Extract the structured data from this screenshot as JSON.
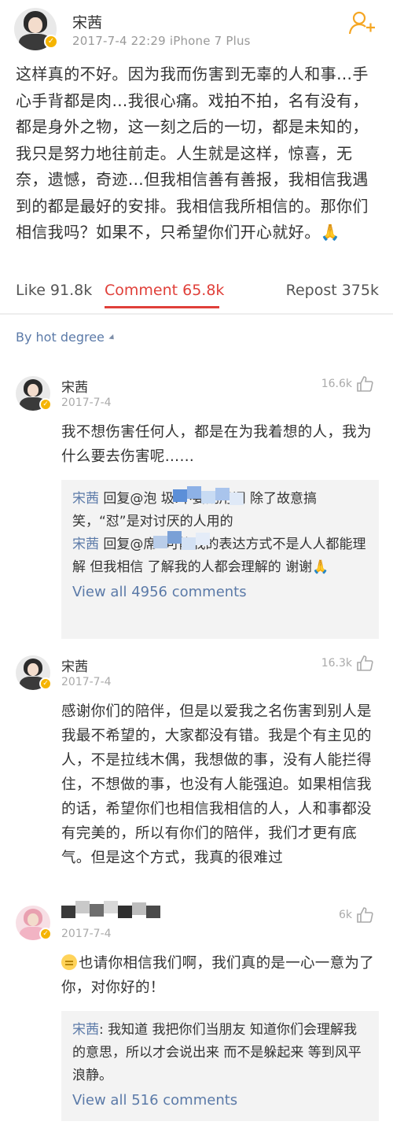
{
  "post": {
    "author": "宋茜",
    "meta": "2017-7-4 22:29   iPhone 7 Plus",
    "body": "这样真的不好。因为我而伤害到无辜的人和事…手心手背都是肉…我很心痛。戏拍不拍，名有没有，都是身外之物，这一刻之后的一切，都是未知的，我只是努力地往前走。人生就是这样，惊喜，无奈，遗憾，奇迹…但我相信善有善报，我相信我遇到的都是最好的安排。我相信我所相信的。那你们相信我吗？如果不，只希望你们开心就好。🙏"
  },
  "actions": {
    "like": "Like 91.8k",
    "comment": "Comment 65.8k",
    "repost": "Repost 375k"
  },
  "sort_label": "By hot degree",
  "comments": [
    {
      "name": "宋茜",
      "date": "2017-7-4",
      "likes": "16.6k",
      "text": "我不想伤害任何人，都是在为我着想的人，我为什么要去伤害呢……",
      "replies": [
        {
          "author": "宋茜",
          "text": " 回复@泡           圾:不要乱用词 除了故意搞笑，“怼”是对讨厌的人用的"
        },
        {
          "author": "宋茜",
          "text": " 回复@席     :可能我的表达方式不是人人都能理解 但我相信 了解我的人都会理解的 谢谢🙏"
        }
      ],
      "view_all": "View all 4956 comments"
    },
    {
      "name": "宋茜",
      "date": "2017-7-4",
      "likes": "16.3k",
      "text": "感谢你们的陪伴，但是以爱我之名伤害到别人是我最不希望的，大家都没有错。我是个有主见的人，不是拉线木偶，我想做的事，没有人能拦得住，不想做的事，也没有人能强迫。如果相信我的话，希望你们也相信我相信的人，人和事都没有完美的，所以有你们的陪伴，我们才更有底气。但是这个方式，我真的很难过"
    },
    {
      "name": "",
      "date": "2017-7-4",
      "likes": "6k",
      "text": "也请你相信我们啊，我们真的是一心一意为了你，对你好的！",
      "replies": [
        {
          "author": "宋茜",
          "text": ": 我知道 我把你们当朋友 知道你们会理解我的意思，所以才会说出来 而不是躲起来 等到风平浪静。"
        }
      ],
      "view_all": "View all 516 comments"
    }
  ],
  "colors": {
    "link": "#5b7aa8",
    "active": "#e0403a",
    "vip_badge": "#f5b400",
    "follow_icon": "#f5a623"
  },
  "icons": [
    "follow-add-icon",
    "verified-badge-icon",
    "thumbs-up-icon",
    "sort-triangle-icon",
    "pray-emoji",
    "awkward-emoji"
  ]
}
